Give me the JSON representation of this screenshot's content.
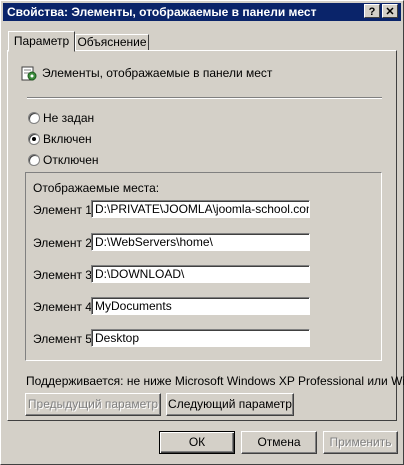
{
  "window": {
    "title": "Свойства: Элементы, отображаемые в панели мест",
    "help_btn": "?",
    "close_btn": "✕"
  },
  "tabs": [
    {
      "label": "Параметр",
      "active": true
    },
    {
      "label": "Объяснение",
      "active": false
    }
  ],
  "setting": {
    "title": "Элементы, отображаемые в панели мест",
    "icon": "policy-setting-icon"
  },
  "radios": [
    {
      "label": "Не задан",
      "checked": false
    },
    {
      "label": "Включен",
      "checked": true
    },
    {
      "label": "Отключен",
      "checked": false
    }
  ],
  "group": {
    "title": "Отображаемые места:",
    "elements": [
      {
        "label": "Элемент 1",
        "value": "D:\\PRIVATE\\JOOMLA\\joomla-school.com\\"
      },
      {
        "label": "Элемент 2",
        "value": "D:\\WebServers\\home\\"
      },
      {
        "label": "Элемент 3",
        "value": "D:\\DOWNLOAD\\"
      },
      {
        "label": "Элемент 4",
        "value": "MyDocuments"
      },
      {
        "label": "Элемент 5",
        "value": "Desktop"
      }
    ]
  },
  "supported": "Поддерживается:  не ниже Microsoft Windows XP Professional или Wi...",
  "nav": {
    "prev": "Предыдущий параметр",
    "next": "Следующий параметр"
  },
  "buttons": {
    "ok": "ОК",
    "cancel": "Отмена",
    "apply": "Применить"
  }
}
